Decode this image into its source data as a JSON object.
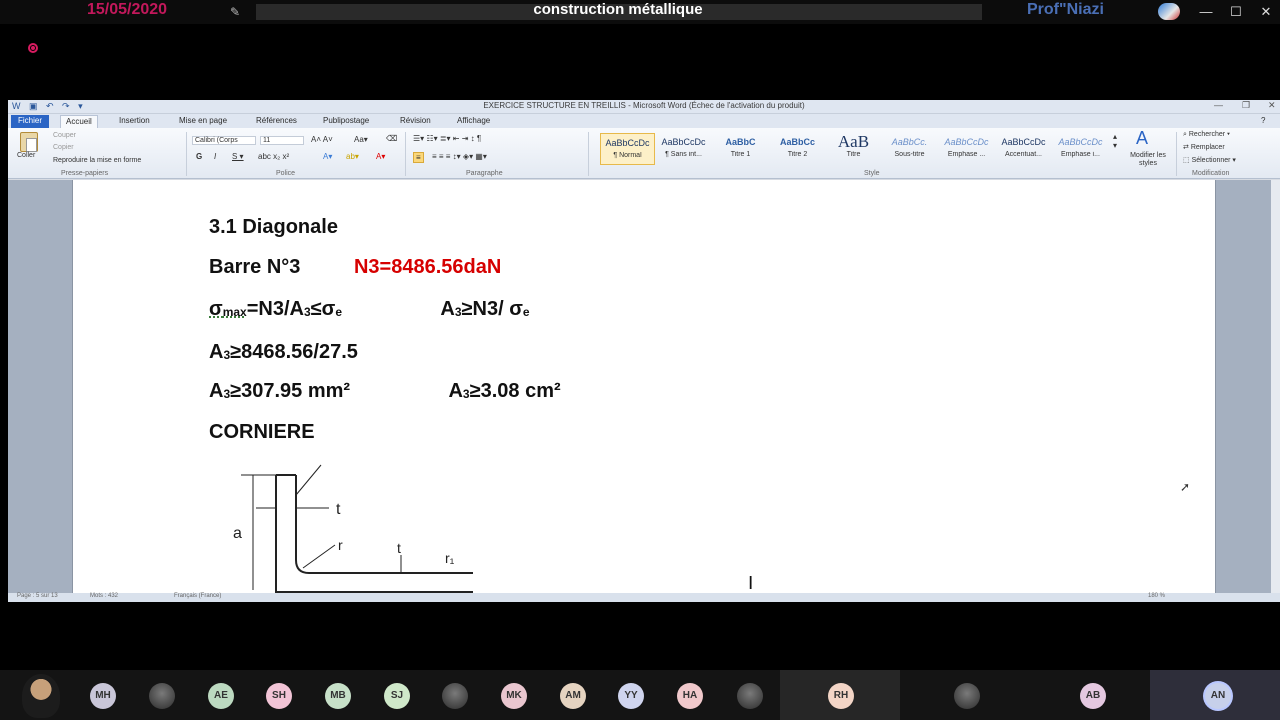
{
  "call": {
    "date": "15/05/2020",
    "title": "construction métallique",
    "presenter": "Prof\"Niazi",
    "window_controls": [
      "—",
      "☐",
      "✕"
    ]
  },
  "word": {
    "doc_title": "EXERCICE STRUCTURE EN TREILLIS  -  Microsoft Word (Échec de l'activation du produit)",
    "tabs": [
      "Fichier",
      "Accueil",
      "Insertion",
      "Mise en page",
      "Références",
      "Publipostage",
      "Révision",
      "Affichage"
    ],
    "clipboard": {
      "paste": "Coller",
      "cut": "Couper",
      "copy": "Copier",
      "format_painter": "Reproduire la mise en forme",
      "group": "Presse-papiers"
    },
    "font": {
      "name": "Calibri (Corps",
      "size": "11",
      "group": "Police"
    },
    "paragraph_group": "Paragraphe",
    "styles": [
      {
        "sample": "AaBbCcDc",
        "name": "¶ Normal"
      },
      {
        "sample": "AaBbCcDc",
        "name": "¶ Sans int..."
      },
      {
        "sample": "AaBbC",
        "name": "Titre 1"
      },
      {
        "sample": "AaBbCc",
        "name": "Titre 2"
      },
      {
        "sample": "AaB",
        "name": "Titre"
      },
      {
        "sample": "AaBbCc.",
        "name": "Sous-titre"
      },
      {
        "sample": "AaBbCcDc",
        "name": "Emphase ..."
      },
      {
        "sample": "AaBbCcDc",
        "name": "Accentuat..."
      },
      {
        "sample": "AaBbCcDc",
        "name": "Emphase i..."
      }
    ],
    "styles_group": "Style",
    "modify_styles": "Modifier les styles",
    "editing": {
      "find": "Rechercher",
      "replace": "Remplacer",
      "select": "Sélectionner",
      "group": "Modification"
    },
    "status": {
      "page": "Page : 5 sur 13",
      "words": "Mots : 432",
      "language": "Français (France)",
      "zoom": "180 %"
    }
  },
  "document": {
    "heading": "3.1 Diagonale",
    "bar": "Barre N°3",
    "force": "N3=8486.56daN",
    "sigma_max": "σ",
    "sigma_max_sub": "max",
    "eq1_rest": "=N3/A",
    "eq1_sub": "3",
    "eq1_tail": "≤σ",
    "eq1_tail_sub": "e",
    "eq2_a": "A",
    "eq2_sub": "3",
    "eq2_rest": "≥N3/ σ",
    "eq2_sub2": "e",
    "line3_a": "A",
    "line3_sub": "3",
    "line3_rest": "≥8468.56/27.5",
    "line4_a": "A",
    "line4_sub": "3",
    "line4_rest": "≥307.95 mm²",
    "line4b_a": "A",
    "line4b_sub": "3",
    "line4b_rest": "≥3.08 cm²",
    "section": "CORNIERE",
    "fig_labels": {
      "a": "a",
      "t": "t",
      "r": "r",
      "t2": "t",
      "r1": "r₁"
    }
  },
  "participants": [
    "MH",
    "",
    "AE",
    "SH",
    "MB",
    "SJ",
    "",
    "MK",
    "AM",
    "YY",
    "HA",
    "",
    "RH",
    "",
    "AB",
    "AN"
  ]
}
